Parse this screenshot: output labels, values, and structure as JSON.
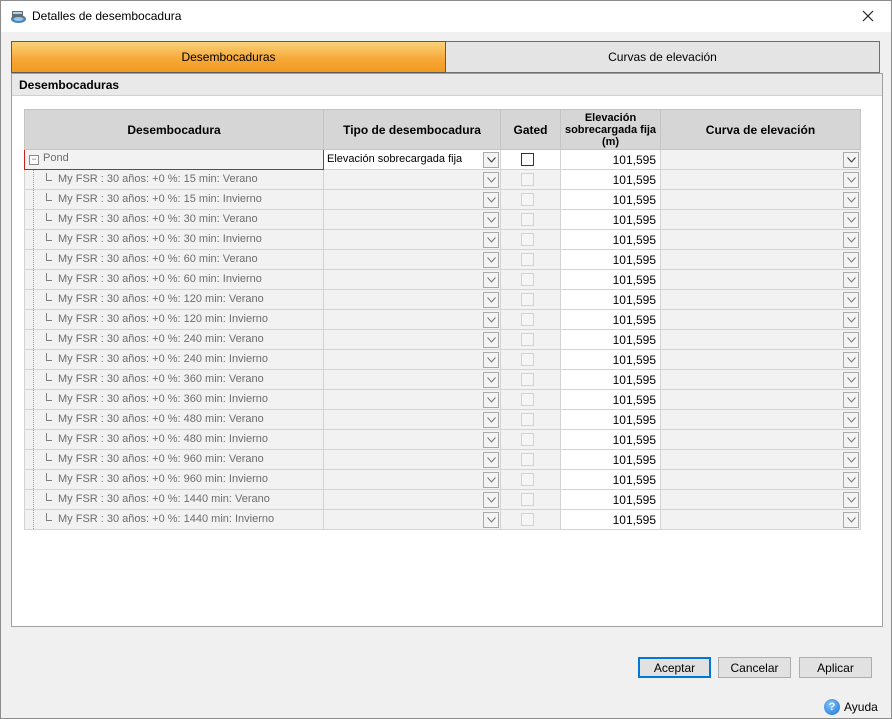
{
  "window": {
    "title": "Detalles de desembocadura"
  },
  "tabs": [
    {
      "label": "Desembocaduras",
      "active": true
    },
    {
      "label": "Curvas de elevación",
      "active": false
    }
  ],
  "panel": {
    "header": "Desembocaduras"
  },
  "grid": {
    "columns": {
      "desembocadura": "Desembocadura",
      "tipo": "Tipo de desembocadura",
      "gated": "Gated",
      "elevacion": "Elevación sobrecargada fija (m)",
      "curva": "Curva de elevación"
    },
    "parent": {
      "name": "Pond",
      "type": "Elevación sobrecargada fija",
      "elevation": "101,595",
      "gated": false
    },
    "rows": [
      {
        "name": "My FSR : 30 años: +0 %: 15 min: Verano",
        "elevation": "101,595"
      },
      {
        "name": "My FSR : 30 años: +0 %: 15 min: Invierno",
        "elevation": "101,595"
      },
      {
        "name": "My FSR : 30 años: +0 %: 30 min: Verano",
        "elevation": "101,595"
      },
      {
        "name": "My FSR : 30 años: +0 %: 30 min: Invierno",
        "elevation": "101,595"
      },
      {
        "name": "My FSR : 30 años: +0 %: 60 min: Verano",
        "elevation": "101,595"
      },
      {
        "name": "My FSR : 30 años: +0 %: 60 min: Invierno",
        "elevation": "101,595"
      },
      {
        "name": "My FSR : 30 años: +0 %: 120 min: Verano",
        "elevation": "101,595"
      },
      {
        "name": "My FSR : 30 años: +0 %: 120 min: Invierno",
        "elevation": "101,595"
      },
      {
        "name": "My FSR : 30 años: +0 %: 240 min: Verano",
        "elevation": "101,595"
      },
      {
        "name": "My FSR : 30 años: +0 %: 240 min: Invierno",
        "elevation": "101,595"
      },
      {
        "name": "My FSR : 30 años: +0 %: 360 min: Verano",
        "elevation": "101,595"
      },
      {
        "name": "My FSR : 30 años: +0 %: 360 min: Invierno",
        "elevation": "101,595"
      },
      {
        "name": "My FSR : 30 años: +0 %: 480 min: Verano",
        "elevation": "101,595"
      },
      {
        "name": "My FSR : 30 años: +0 %: 480 min: Invierno",
        "elevation": "101,595"
      },
      {
        "name": "My FSR : 30 años: +0 %: 960 min: Verano",
        "elevation": "101,595"
      },
      {
        "name": "My FSR : 30 años: +0 %: 960 min: Invierno",
        "elevation": "101,595"
      },
      {
        "name": "My FSR : 30 años: +0 %: 1440 min: Verano",
        "elevation": "101,595"
      },
      {
        "name": "My FSR : 30 años: +0 %: 1440 min: Invierno",
        "elevation": "101,595"
      }
    ]
  },
  "buttons": {
    "accept": "Aceptar",
    "cancel": "Cancelar",
    "apply": "Aplicar"
  },
  "help": {
    "label": "Ayuda"
  },
  "colors": {
    "active_tab": "#f6a93a",
    "selection_border": "#c81e1e",
    "default_button": "#0078d7"
  },
  "icons": {
    "app": "outfall-app-icon",
    "close": "close-icon",
    "dropdown": "chevron-down-icon",
    "help": "help-icon",
    "expander": "collapse-icon"
  }
}
